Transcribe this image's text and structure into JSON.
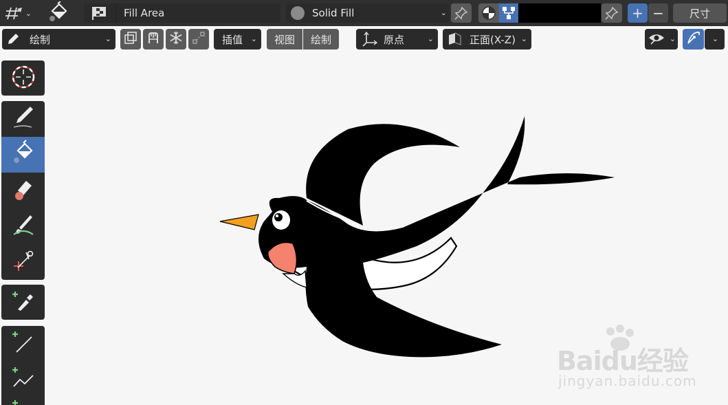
{
  "header": {
    "material_name": "Fill Area",
    "fill_mode": "Solid Fill",
    "size_label": "尺寸",
    "add_symbol": "+",
    "remove_symbol": "−"
  },
  "tool_header": {
    "mode_label": "绘制",
    "interpolate_label": "插值",
    "view_menu": "视图",
    "draw_menu": "绘制",
    "origin_label": "原点",
    "view_label": "正面(X-Z)"
  },
  "toolbar": {
    "tools": [
      "cursor",
      "draw",
      "fill",
      "erase",
      "tint",
      "cutter",
      "eyedropper",
      "line",
      "polyline"
    ],
    "active_tool": "fill"
  },
  "watermark": {
    "brand": "Baidu经验",
    "url": "jingyan.baidu.com"
  },
  "colors": {
    "accent": "#4772b3",
    "header_bg": "#303030",
    "viewport_bg": "#f6f6f6",
    "beak": "#f2a020",
    "cheek": "#f4826e"
  }
}
